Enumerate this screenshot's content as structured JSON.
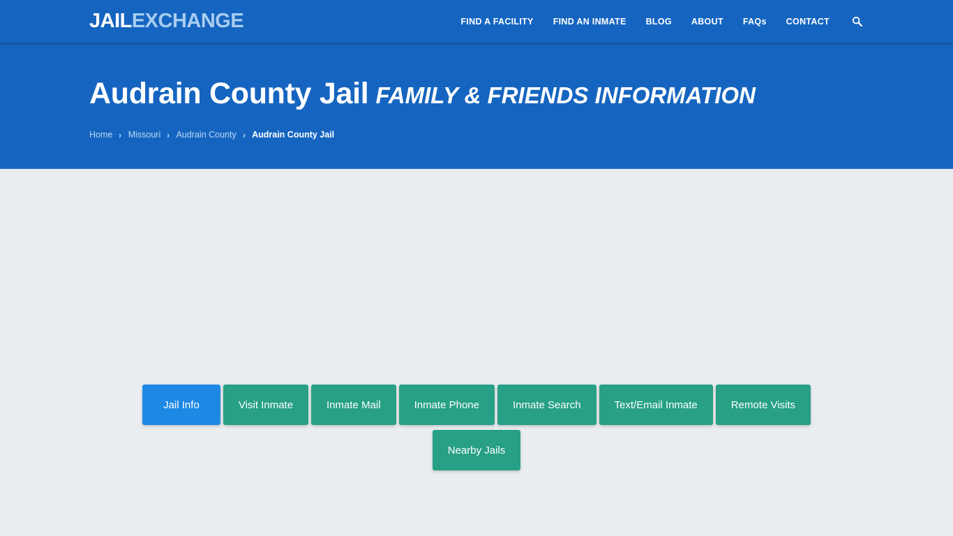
{
  "navbar": {
    "logo": {
      "part1": "JAIL",
      "part2": "EXCHANGE"
    },
    "menu": [
      {
        "label": "FIND A FACILITY",
        "name": "nav-find-a-facility"
      },
      {
        "label": "FIND AN INMATE",
        "name": "nav-find-an-inmate"
      },
      {
        "label": "BLOG",
        "name": "nav-blog"
      },
      {
        "label": "ABOUT",
        "name": "nav-about"
      },
      {
        "label": "FAQs",
        "name": "nav-faqs"
      },
      {
        "label": "CONTACT",
        "name": "nav-contact"
      }
    ],
    "search_icon": "search-icon"
  },
  "hero": {
    "title_main": "Audrain County Jail",
    "title_sub": "FAMILY & FRIENDS INFORMATION",
    "breadcrumb": [
      {
        "label": "Home",
        "current": false
      },
      {
        "label": "Missouri",
        "current": false
      },
      {
        "label": "Audrain County",
        "current": false
      },
      {
        "label": "Audrain County Jail",
        "current": true
      }
    ],
    "breadcrumb_separator": "›"
  },
  "main": {
    "tabs_row1": [
      {
        "label": "Jail Info",
        "active": true
      },
      {
        "label": "Visit Inmate",
        "active": false
      },
      {
        "label": "Inmate Mail",
        "active": false
      },
      {
        "label": "Inmate Phone",
        "active": false
      },
      {
        "label": "Inmate Search",
        "active": false
      },
      {
        "label": "Text/Email Inmate",
        "active": false
      },
      {
        "label": "Remote Visits",
        "active": false
      }
    ],
    "tabs_row2": [
      {
        "label": "Nearby Jails",
        "active": false
      }
    ]
  },
  "colors": {
    "header_blue": "#1565c0",
    "nav_divider": "#12539e",
    "logo_accent": "#a8cdf0",
    "content_bg": "#eaedf0",
    "button_teal": "#27a085",
    "button_active_blue": "#1e88e5"
  }
}
